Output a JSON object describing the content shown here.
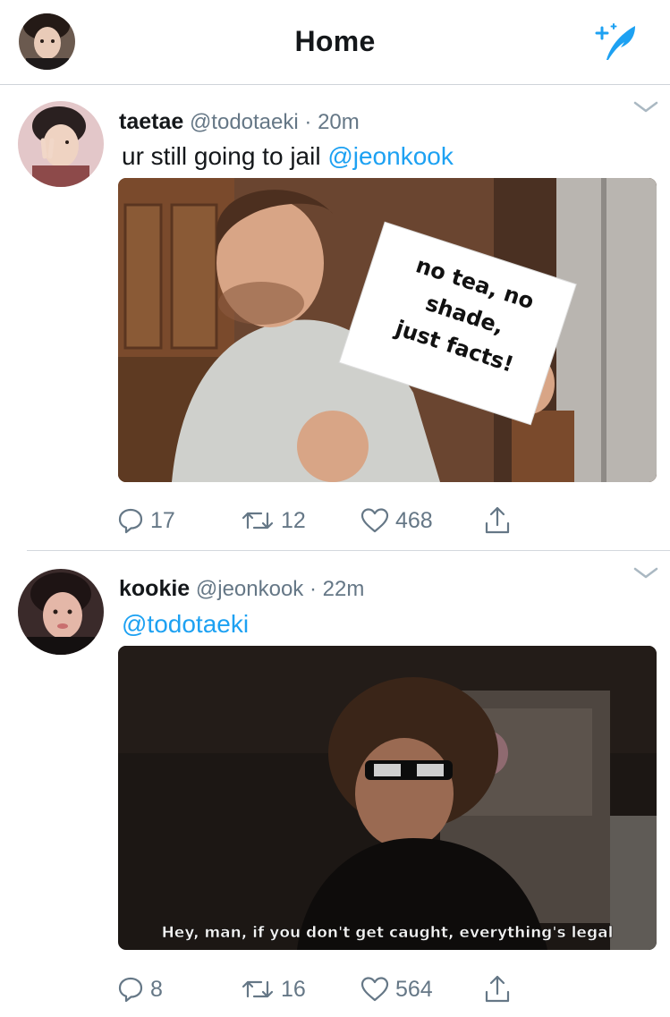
{
  "header": {
    "title": "Home",
    "left_icon": "profile-avatar",
    "right_icon": "compose-sparkle-icon",
    "accent_color": "#1da1f2"
  },
  "tweets": [
    {
      "name": "taetae",
      "handle": "@todotaeki",
      "separator": "·",
      "time": "20m",
      "text": "ur still going to jail ",
      "mention": "@jeonkook",
      "media": {
        "sign_lines": [
          "no tea, no",
          "shade,",
          "just facts!"
        ]
      },
      "actions": {
        "replies": "17",
        "retweets": "12",
        "likes": "468"
      }
    },
    {
      "name": "kookie",
      "handle": "@jeonkook",
      "separator": "·",
      "time": "22m",
      "text": "",
      "mention": "@todotaeki",
      "media": {
        "caption": "Hey, man, if you don't get caught, everything's legal"
      },
      "actions": {
        "replies": "8",
        "retweets": "16",
        "likes": "564"
      }
    }
  ]
}
